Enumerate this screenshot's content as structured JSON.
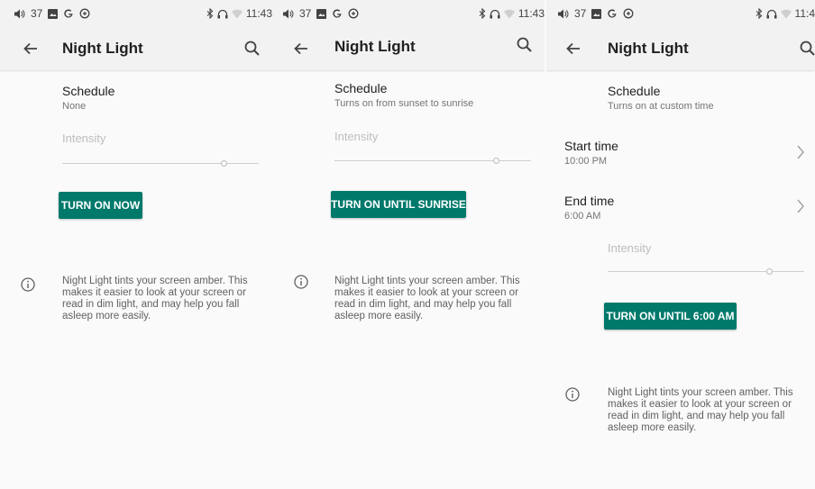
{
  "colors": {
    "accent": "#00796b",
    "appbar": "#f2f2f2",
    "background": "#fafafa"
  },
  "status": {
    "volume": "37",
    "time_full": "11:43",
    "time_clipped": "11:4"
  },
  "icons": [
    "back-arrow-icon",
    "search-icon",
    "info-icon",
    "chevron-right-icon",
    "volume-icon",
    "gallery-icon",
    "google-icon",
    "data-saver-icon",
    "bluetooth-icon",
    "headset-icon",
    "wifi-icon"
  ],
  "screens": [
    {
      "title": "Night Light",
      "schedule_label": "Schedule",
      "schedule_value": "None",
      "intensity_label": "Intensity",
      "intensity_level": 0.82,
      "button_label": "TURN ON NOW",
      "info_text": "Night Light tints your screen amber. This makes it easier to look at your screen or read in dim light, and may help you fall asleep more easily."
    },
    {
      "title": "Night Light",
      "schedule_label": "Schedule",
      "schedule_value": "Turns on from sunset to sunrise",
      "intensity_label": "Intensity",
      "intensity_level": 0.82,
      "button_label": "TURN ON UNTIL SUNRISE",
      "info_text": "Night Light tints your screen amber. This makes it easier to look at your screen or read in dim light, and may help you fall asleep more easily."
    },
    {
      "title": "Night Light",
      "schedule_label": "Schedule",
      "schedule_value": "Turns on at custom time",
      "start_label": "Start time",
      "start_value": "10:00 PM",
      "end_label": "End time",
      "end_value": "6:00 AM",
      "intensity_label": "Intensity",
      "intensity_level": 0.82,
      "button_label": "TURN ON UNTIL 6:00 AM",
      "info_text": "Night Light tints your screen amber. This makes it easier to look at your screen or read in dim light, and may help you fall asleep more easily."
    }
  ]
}
